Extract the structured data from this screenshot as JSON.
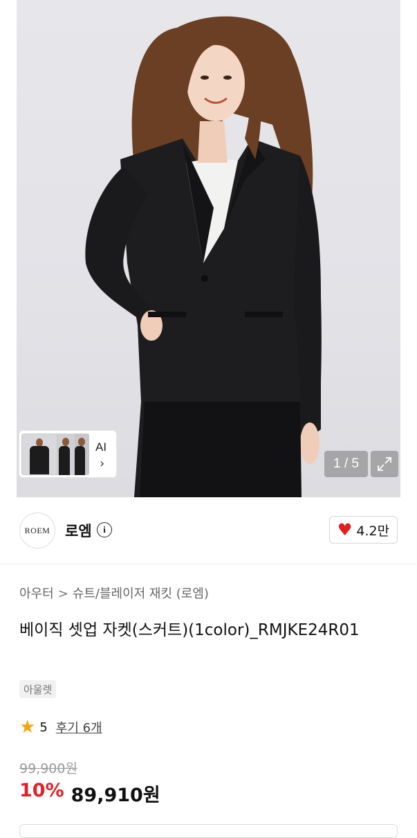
{
  "gallery": {
    "counter": "1 / 5",
    "ai_label": "AI",
    "icons": {
      "expand": "expand-icon",
      "chevron": "chevron-right-icon"
    }
  },
  "brand": {
    "logo_text": "ROEM",
    "name": "로엠",
    "info_icon": "info-icon",
    "likes": "4.2만",
    "heart_color": "#e02020"
  },
  "breadcrumb": {
    "items": [
      "아우터",
      "슈트/블레이저 재킷 (로엠)"
    ],
    "separator": ">"
  },
  "product": {
    "title": "베이직 셋업 자켓(스커트)(1color)_RMJKE24R01",
    "tag": "아울렛",
    "rating": "5",
    "reviews": "후기 6개",
    "original_price": "99,900원",
    "discount": "10%",
    "final_price": "89,910원",
    "discount_color": "#e0232b",
    "star_color": "#f0a512"
  }
}
